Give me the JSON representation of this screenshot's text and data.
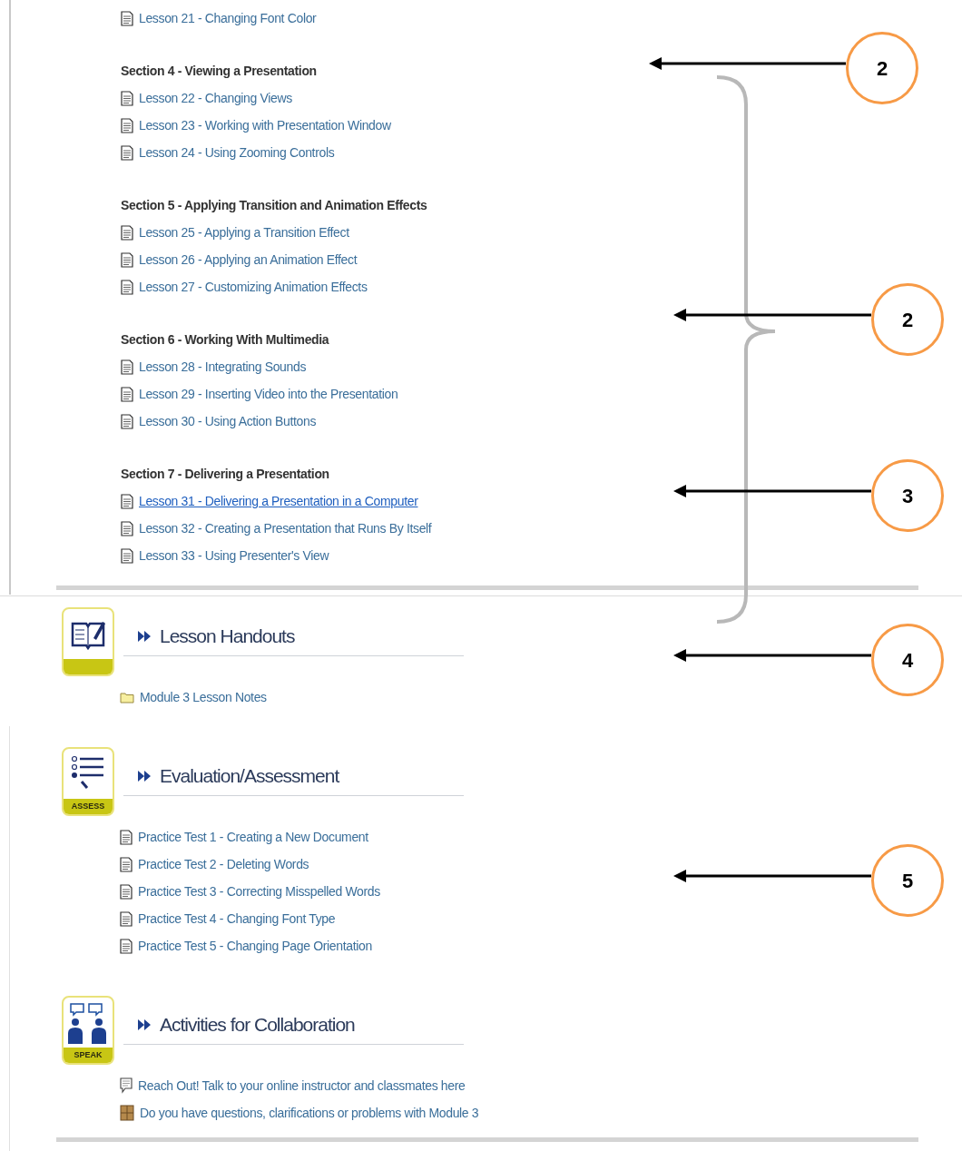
{
  "top_lessons": [
    {
      "label": "Lesson 21 - Changing Font Color",
      "hovered": false
    }
  ],
  "sections": [
    {
      "title": "Section 4 - Viewing a Presentation",
      "lessons": [
        {
          "label": "Lesson 22 - Changing Views",
          "hovered": false
        },
        {
          "label": "Lesson 23 - Working with Presentation Window",
          "hovered": false
        },
        {
          "label": "Lesson 24 - Using Zooming Controls",
          "hovered": false
        }
      ]
    },
    {
      "title": "Section 5 - Applying Transition and Animation Effects",
      "lessons": [
        {
          "label": "Lesson 25 - Applying a Transition Effect",
          "hovered": false
        },
        {
          "label": "Lesson 26 - Applying an Animation Effect",
          "hovered": false
        },
        {
          "label": "Lesson 27 - Customizing Animation Effects",
          "hovered": false
        }
      ]
    },
    {
      "title": "Section 6 - Working With Multimedia",
      "lessons": [
        {
          "label": "Lesson 28 - Integrating Sounds",
          "hovered": false
        },
        {
          "label": "Lesson 29 - Inserting Video into the Presentation",
          "hovered": false
        },
        {
          "label": "Lesson 30 - Using Action Buttons",
          "hovered": false
        }
      ]
    },
    {
      "title": "Section 7 - Delivering a Presentation",
      "lessons": [
        {
          "label": "Lesson 31 - Delivering a Presentation in a Computer",
          "hovered": true
        },
        {
          "label": "Lesson 32 - Creating a Presentation that Runs By Itself",
          "hovered": false
        },
        {
          "label": "Lesson 33 - Using Presenter's View",
          "hovered": false
        }
      ]
    }
  ],
  "modules": [
    {
      "kind": "note",
      "title": "Lesson Handouts",
      "items": [
        {
          "kind": "folder",
          "label": "Module 3 Lesson Notes"
        }
      ]
    },
    {
      "kind": "assess",
      "badge": "ASSESS",
      "title": "Evaluation/Assessment",
      "items": [
        {
          "kind": "document",
          "label": "Practice Test 1 - Creating a New Document"
        },
        {
          "kind": "document",
          "label": "Practice Test 2 - Deleting Words"
        },
        {
          "kind": "document",
          "label": "Practice Test 3 - Correcting Misspelled Words"
        },
        {
          "kind": "document",
          "label": "Practice Test 4 - Changing Font Type"
        },
        {
          "kind": "document",
          "label": "Practice Test 5 - Changing Page Orientation"
        }
      ]
    },
    {
      "kind": "speak",
      "badge": "SPEAK",
      "title": "Activities for Collaboration",
      "items": [
        {
          "kind": "speech",
          "label": "Reach Out! Talk to your online instructor and classmates here"
        },
        {
          "kind": "box",
          "label": "Do you have questions, clarifications or problems with Module 3"
        }
      ]
    }
  ],
  "callouts": [
    {
      "label": "2"
    },
    {
      "label": "2"
    },
    {
      "label": "3"
    },
    {
      "label": "4"
    },
    {
      "label": "5"
    }
  ]
}
